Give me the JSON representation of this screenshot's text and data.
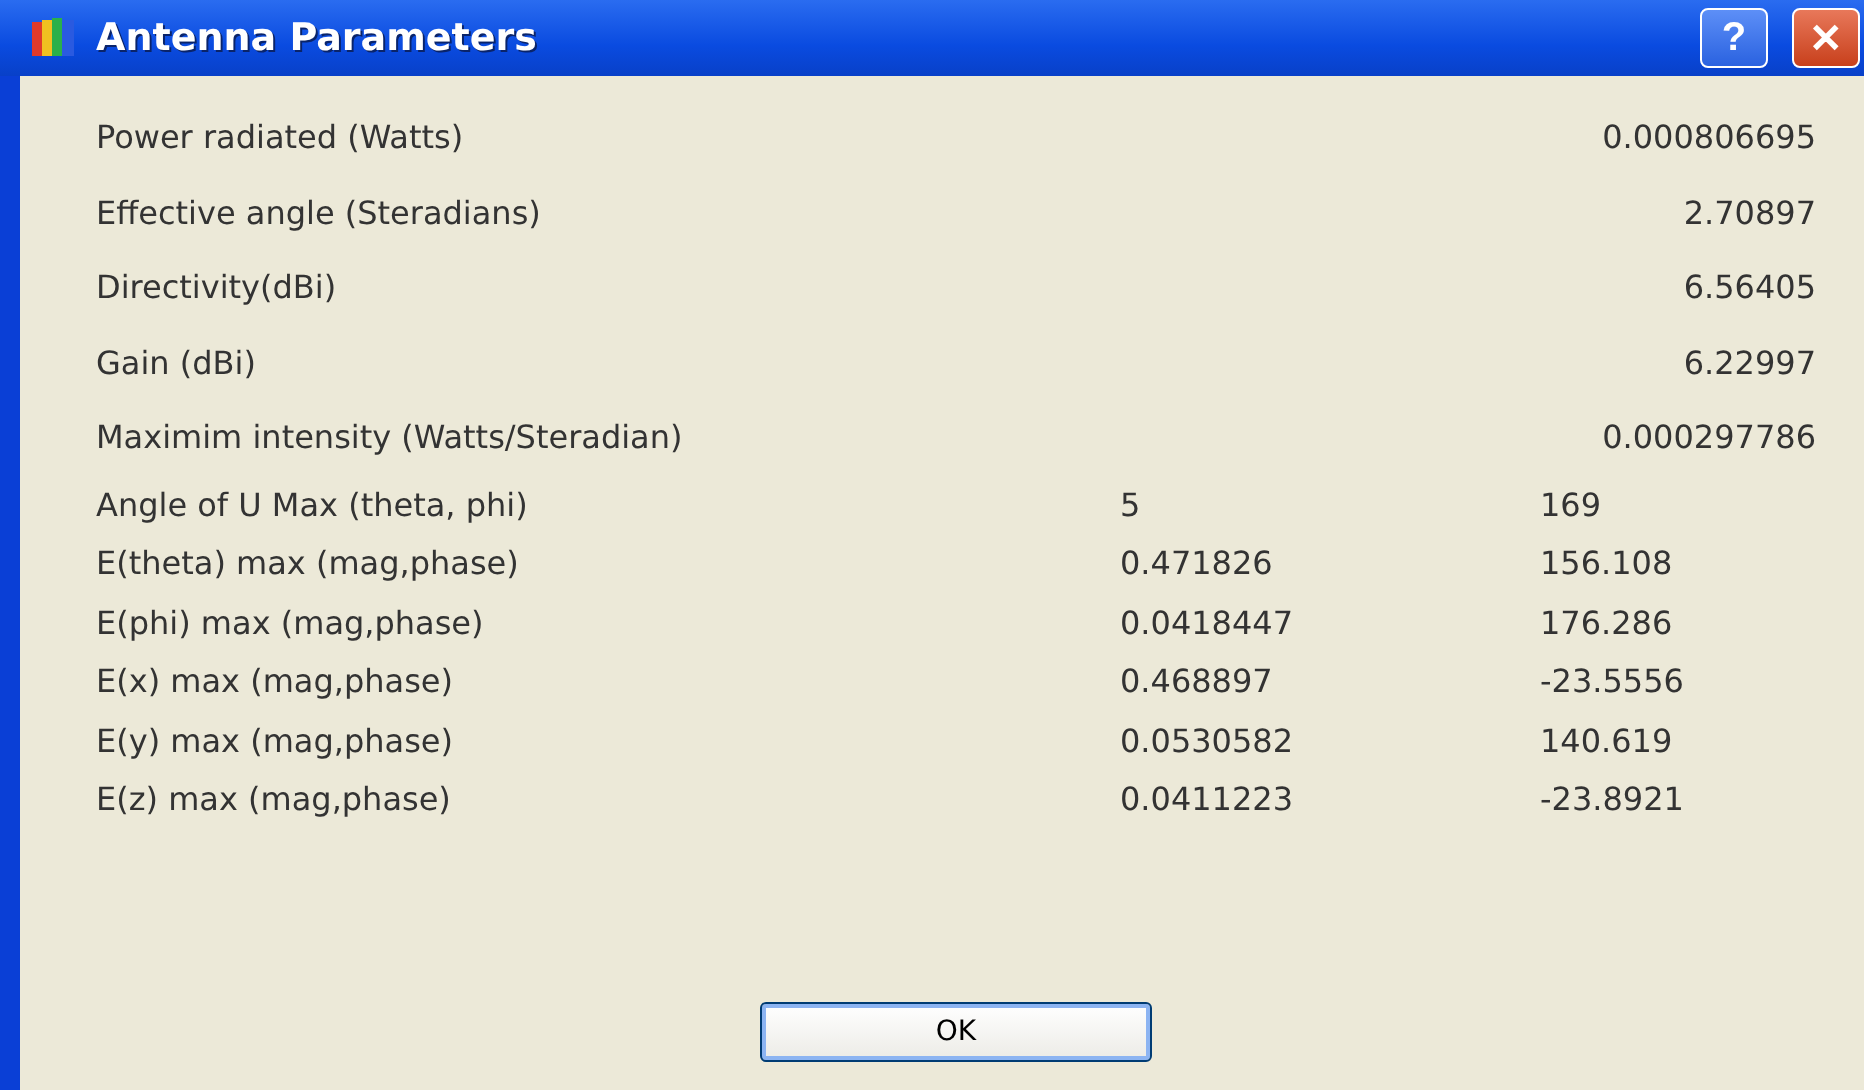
{
  "window": {
    "title": "Antenna Parameters",
    "help_button": "?",
    "close_button": "✕"
  },
  "rows": [
    {
      "kind": "single",
      "label": "Power radiated (Watts)",
      "values": [
        "0.000806695"
      ]
    },
    {
      "kind": "single",
      "label": "Effective angle (Steradians)",
      "values": [
        "2.70897"
      ]
    },
    {
      "kind": "single",
      "label": "Directivity(dBi)",
      "values": [
        "6.56405"
      ]
    },
    {
      "kind": "single",
      "label": "Gain (dBi)",
      "values": [
        "6.22997"
      ]
    },
    {
      "kind": "single",
      "label": "Maximim intensity (Watts/Steradian)",
      "values": [
        "0.000297786"
      ]
    },
    {
      "kind": "pair",
      "label": "Angle of U Max (theta, phi)",
      "values": [
        "5",
        "169"
      ]
    },
    {
      "kind": "pair",
      "label": "E(theta) max (mag,phase)",
      "values": [
        "0.471826",
        "156.108"
      ]
    },
    {
      "kind": "pair",
      "label": "E(phi) max (mag,phase)",
      "values": [
        "0.0418447",
        "176.286"
      ]
    },
    {
      "kind": "pair",
      "label": "E(x) max (mag,phase)",
      "values": [
        "0.468897",
        "-23.5556"
      ]
    },
    {
      "kind": "pair",
      "label": "E(y) max (mag,phase)",
      "values": [
        "0.0530582",
        "140.619"
      ]
    },
    {
      "kind": "pair",
      "label": "E(z) max (mag,phase)",
      "values": [
        "0.0411223",
        "-23.8921"
      ]
    }
  ],
  "buttons": [
    "OK"
  ]
}
